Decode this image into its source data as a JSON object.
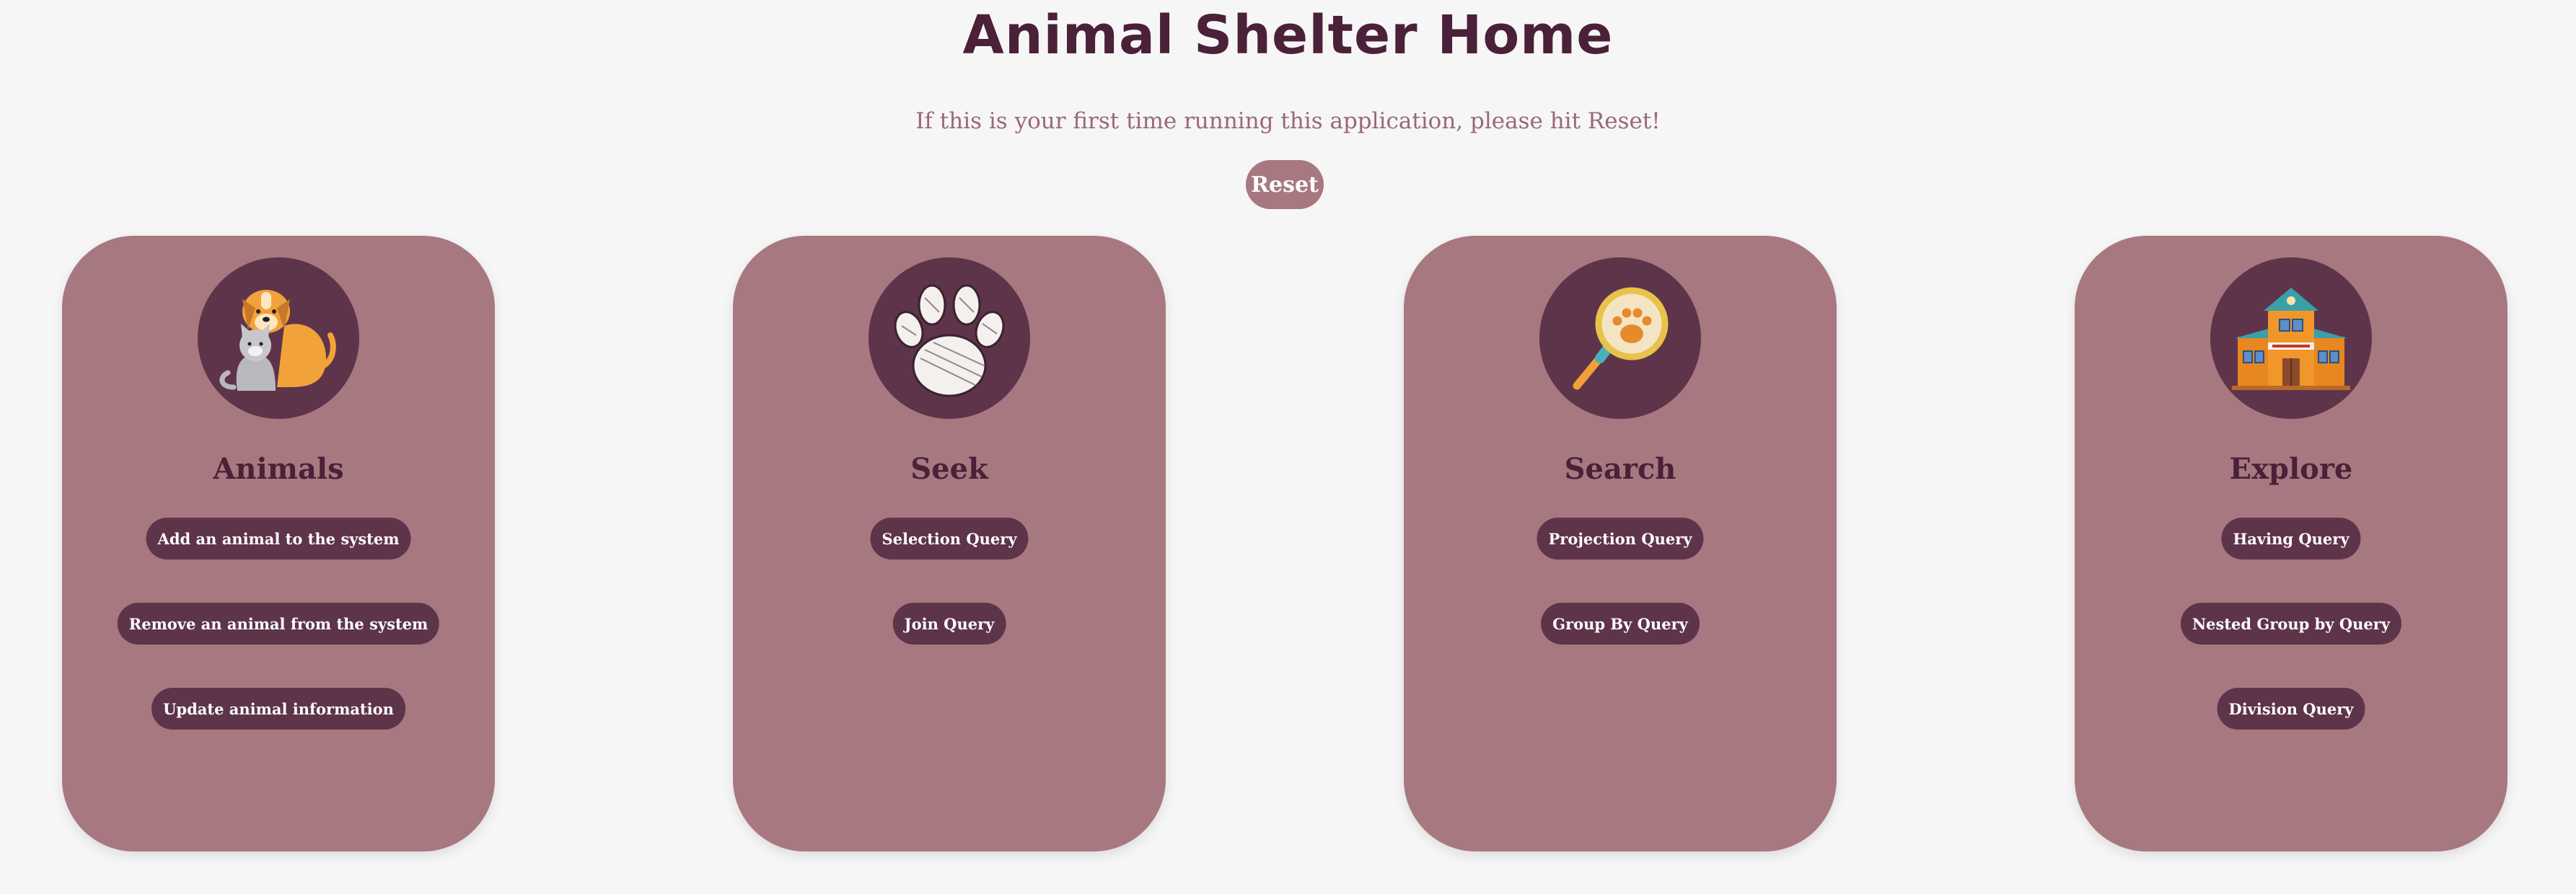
{
  "page": {
    "title": "Animal Shelter Home",
    "subtitle": "If this is your first time running this application, please hit Reset!",
    "reset_label": "Reset"
  },
  "cards": [
    {
      "title": "Animals",
      "icon": "dog-cat-icon",
      "buttons": [
        "Add an animal to the system",
        "Remove an animal from the system",
        "Update animal information"
      ]
    },
    {
      "title": "Seek",
      "icon": "paw-print-icon",
      "buttons": [
        "Selection Query",
        "Join Query"
      ]
    },
    {
      "title": "Search",
      "icon": "magnifier-paw-icon",
      "buttons": [
        "Projection Query",
        "Group By Query"
      ]
    },
    {
      "title": "Explore",
      "icon": "shelter-building-icon",
      "buttons": [
        "Having Query",
        "Nested Group by Query",
        "Division Query"
      ]
    }
  ],
  "colors": {
    "background": "#f6f6f6",
    "card": "#a87880",
    "dark_plum": "#5e344a",
    "title": "#4a2138",
    "subtitle": "#9a6877"
  }
}
